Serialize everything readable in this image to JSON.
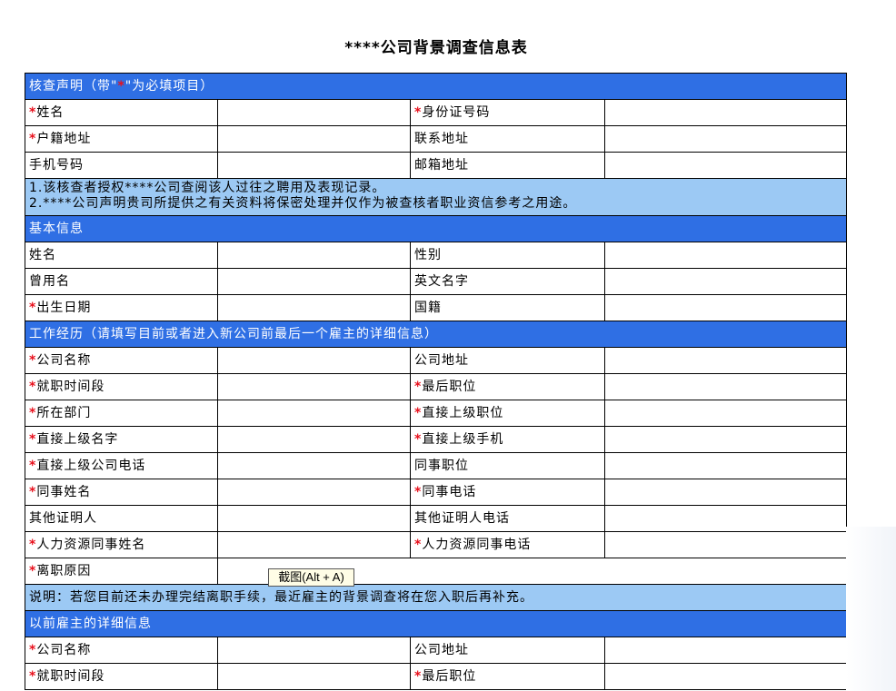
{
  "title": "****公司背景调查信息表",
  "star": "*",
  "tooltip": "截图(Alt + A)",
  "sections": {
    "declaration": {
      "prefix": "核查声明（带\"",
      "suffix": "\"为必填项目）"
    },
    "basic": "基本信息",
    "work": "工作经历（请填写目前或者进入新公司前最后一个雇主的详细信息）",
    "previous": "以前雇主的详细信息"
  },
  "declaration_fields": [
    {
      "left": "姓名",
      "left_required": true,
      "right": "身份证号码",
      "right_required": true
    },
    {
      "left": "户籍地址",
      "left_required": true,
      "right": "联系地址",
      "right_required": false
    },
    {
      "left": "手机号码",
      "left_required": false,
      "right": "邮箱地址",
      "right_required": false
    }
  ],
  "declaration_notes": [
    "1.该核查者授权****公司查阅该人过往之聘用及表现记录。",
    "2.****公司声明贵司所提供之有关资料将保密处理并仅作为被查核者职业资信参考之用途。"
  ],
  "basic_fields": [
    {
      "left": "姓名",
      "left_required": false,
      "right": "性别",
      "right_required": false
    },
    {
      "left": "曾用名",
      "left_required": false,
      "right": "英文名字",
      "right_required": false
    },
    {
      "left": "出生日期",
      "left_required": true,
      "right": "国籍",
      "right_required": false
    }
  ],
  "work_fields": [
    {
      "left": "公司名称",
      "left_required": true,
      "right": "公司地址",
      "right_required": false
    },
    {
      "left": "就职时间段",
      "left_required": true,
      "right": "最后职位",
      "right_required": true
    },
    {
      "left": "所在部门",
      "left_required": true,
      "right": "直接上级职位",
      "right_required": true
    },
    {
      "left": "直接上级名字",
      "left_required": true,
      "right": "直接上级手机",
      "right_required": true
    },
    {
      "left": "直接上级公司电话",
      "left_required": true,
      "right": "同事职位",
      "right_required": false
    },
    {
      "left": "同事姓名",
      "left_required": true,
      "right": "同事电话",
      "right_required": true
    },
    {
      "left": "其他证明人",
      "left_required": false,
      "right": "其他证明人电话",
      "right_required": false
    },
    {
      "left": "人力资源同事姓名",
      "left_required": true,
      "right": "人力资源同事电话",
      "right_required": true
    }
  ],
  "leave_reason": "离职原因",
  "work_note": "说明：若您目前还未办理完结离职手续，最近雇主的背景调查将在您入职后再补充。",
  "previous_fields": [
    {
      "left": "公司名称",
      "left_required": true,
      "right": "公司地址",
      "right_required": false
    },
    {
      "left": "就职时间段",
      "left_required": true,
      "right": "最后职位",
      "right_required": true
    }
  ]
}
